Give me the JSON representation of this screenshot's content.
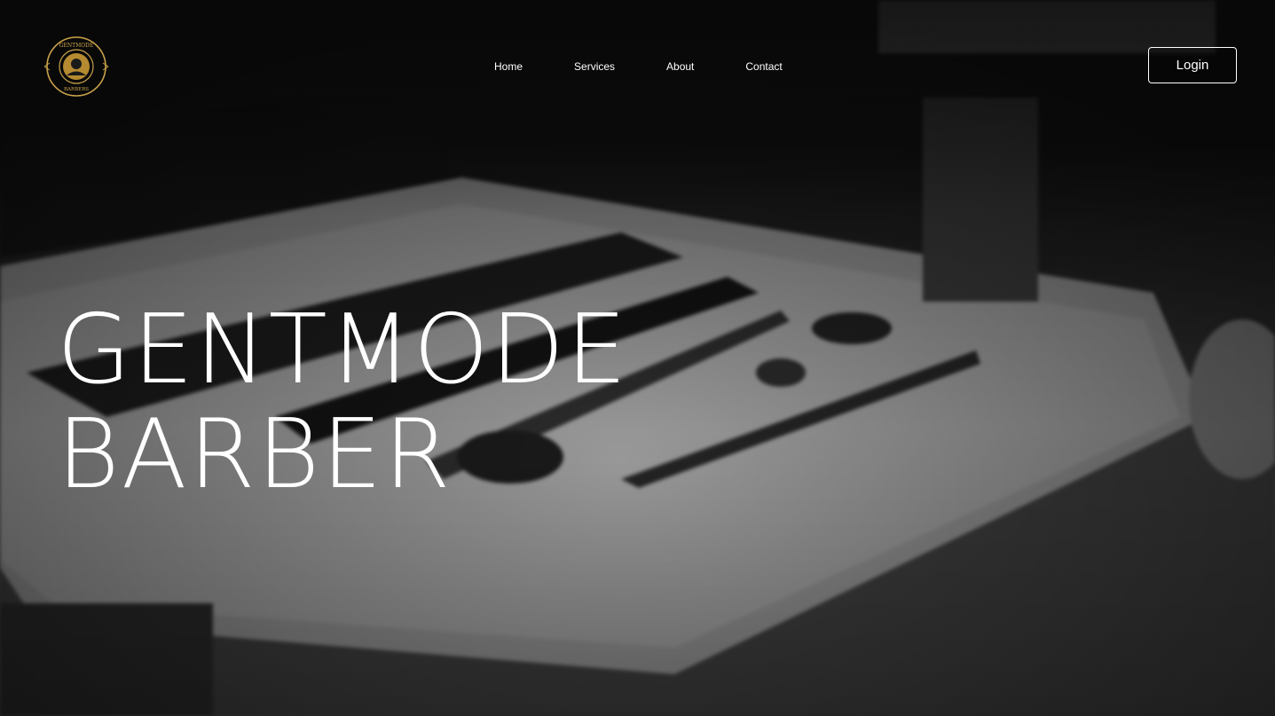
{
  "brand": {
    "logo_top_text": "GENTMODE",
    "logo_bottom_text": "BARBERS",
    "accent": "#c9a24a"
  },
  "nav": {
    "items": [
      {
        "label": "Home"
      },
      {
        "label": "Services"
      },
      {
        "label": "About"
      },
      {
        "label": "Contact"
      }
    ],
    "login_label": "Login"
  },
  "hero": {
    "title_line1": "GENTMODE",
    "title_line2": "BARBER"
  }
}
